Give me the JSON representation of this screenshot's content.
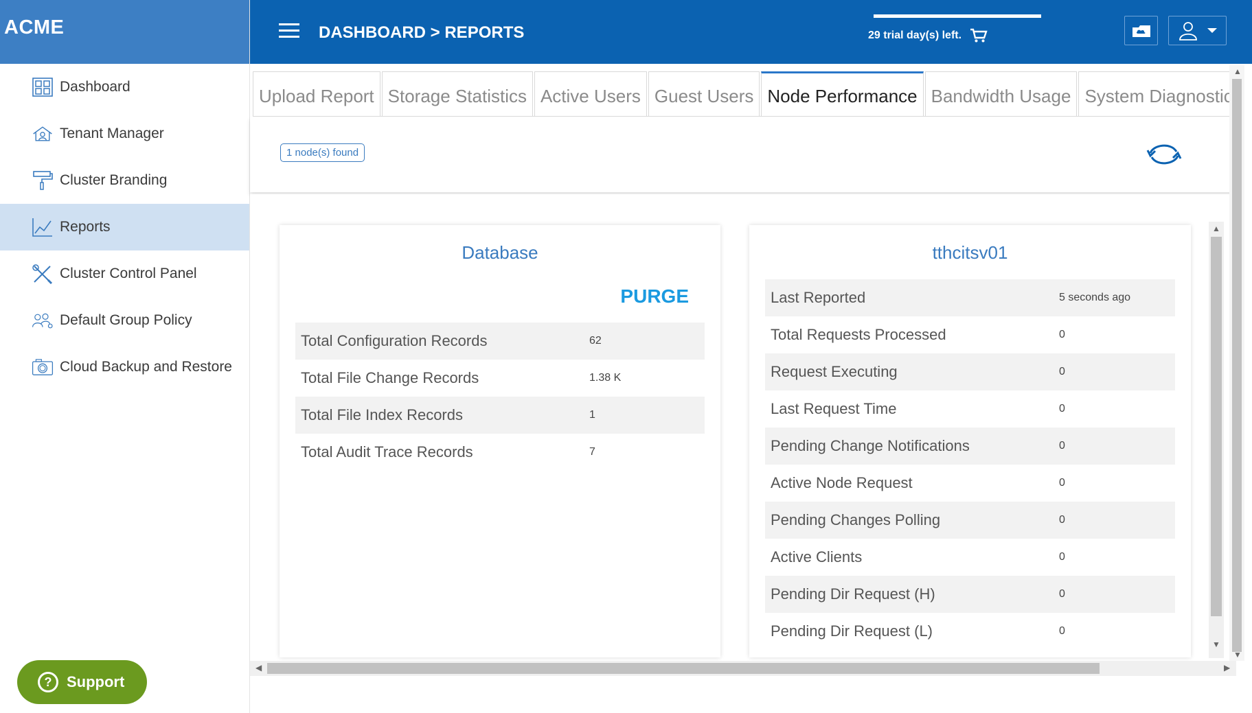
{
  "brand": "ACME",
  "sidebar": {
    "items": [
      {
        "label": "Dashboard",
        "icon": "dashboard-grid-icon"
      },
      {
        "label": "Tenant Manager",
        "icon": "tenant-manager-icon"
      },
      {
        "label": "Cluster Branding",
        "icon": "paint-roller-icon"
      },
      {
        "label": "Reports",
        "icon": "line-chart-icon",
        "active": true
      },
      {
        "label": "Cluster Control Panel",
        "icon": "tools-icon"
      },
      {
        "label": "Default Group Policy",
        "icon": "group-users-icon"
      },
      {
        "label": "Cloud Backup and Restore",
        "icon": "camera-icon"
      }
    ],
    "support_label": "Support"
  },
  "header": {
    "breadcrumb": "DASHBOARD > REPORTS",
    "trial_text": "29 trial day(s) left.",
    "accent": "#0b62b1"
  },
  "tabs": [
    {
      "label": "Upload Report"
    },
    {
      "label": "Storage Statistics"
    },
    {
      "label": "Active Users"
    },
    {
      "label": "Guest Users"
    },
    {
      "label": "Node Performance",
      "active": true
    },
    {
      "label": "Bandwidth Usage"
    },
    {
      "label": "System Diagnostic Repo"
    }
  ],
  "toolbar": {
    "nodes_found": "1 node(s) found"
  },
  "database": {
    "title": "Database",
    "purge_label": "PURGE",
    "rows": [
      {
        "label": "Total Configuration Records",
        "value": "62"
      },
      {
        "label": "Total File Change Records",
        "value": "1.38 K"
      },
      {
        "label": "Total File Index Records",
        "value": "1"
      },
      {
        "label": "Total Audit Trace Records",
        "value": "7"
      }
    ]
  },
  "node": {
    "title": "tthcitsv01",
    "rows": [
      {
        "label": "Last Reported",
        "value": "5 seconds ago"
      },
      {
        "label": "Total Requests Processed",
        "value": "0"
      },
      {
        "label": "Request Executing",
        "value": "0"
      },
      {
        "label": "Last Request Time",
        "value": "0"
      },
      {
        "label": "Pending Change Notifications",
        "value": "0"
      },
      {
        "label": "Active Node Request",
        "value": "0"
      },
      {
        "label": "Pending Changes Polling",
        "value": "0"
      },
      {
        "label": "Active Clients",
        "value": "0"
      },
      {
        "label": "Pending Dir Request (H)",
        "value": "0"
      },
      {
        "label": "Pending Dir Request (L)",
        "value": "0"
      }
    ]
  }
}
